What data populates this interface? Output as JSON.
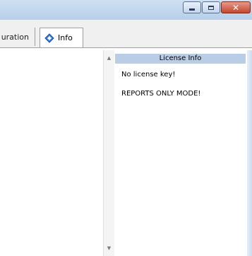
{
  "window": {
    "caption_buttons": [
      "minimize-icon",
      "maximize-icon",
      "close-icon"
    ]
  },
  "tabs": [
    {
      "label": "uration",
      "selected": false
    },
    {
      "label": "Info",
      "selected": true,
      "icon": "diamond-info-icon"
    }
  ],
  "license_panel": {
    "header": "License Info",
    "lines": [
      "No license key!",
      "REPORTS ONLY MODE!"
    ],
    "header_color": "#b9cde6"
  }
}
